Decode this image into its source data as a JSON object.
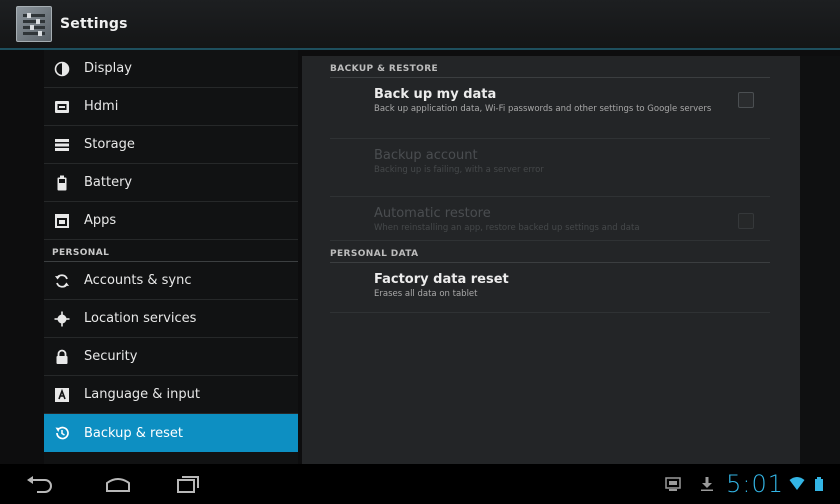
{
  "app": {
    "title": "Settings",
    "icon": "settings-app-icon"
  },
  "sidebar": {
    "items_top": [
      {
        "label": "Display",
        "icon": "display-icon"
      },
      {
        "label": "Hdmi",
        "icon": "hdmi-icon"
      },
      {
        "label": "Storage",
        "icon": "storage-icon"
      },
      {
        "label": "Battery",
        "icon": "battery-icon"
      },
      {
        "label": "Apps",
        "icon": "apps-icon"
      }
    ],
    "personal_header": "PERSONAL",
    "items_personal": [
      {
        "label": "Accounts & sync",
        "icon": "sync-icon"
      },
      {
        "label": "Location services",
        "icon": "location-icon"
      },
      {
        "label": "Security",
        "icon": "lock-icon"
      },
      {
        "label": "Language & input",
        "icon": "language-icon"
      },
      {
        "label": "Backup & reset",
        "icon": "backup-icon",
        "selected": true
      }
    ]
  },
  "content": {
    "backup_header": "BACKUP & RESTORE",
    "backup_prefs": [
      {
        "title": "Back up my data",
        "summary": "Back up application data, Wi-Fi passwords and other settings to Google servers",
        "checked": false,
        "enabled": true
      },
      {
        "title": "Backup account",
        "summary": "Backing up is failing, with a server error",
        "enabled": false
      },
      {
        "title": "Automatic restore",
        "summary": "When reinstalling an app, restore backed up settings and data",
        "checked": false,
        "enabled": false
      }
    ],
    "personal_data_header": "PERSONAL DATA",
    "factory": {
      "title": "Factory data reset",
      "summary": "Erases all data on tablet"
    }
  },
  "navbar": {
    "back_icon": "back-icon",
    "home_icon": "home-icon",
    "recents_icon": "recent-apps-icon"
  },
  "status": {
    "time": "5:01",
    "icons": [
      "screenshot-icon",
      "download-icon",
      "wifi-icon",
      "battery-status-icon"
    ],
    "accent": "#33b5e5"
  },
  "colors": {
    "selected": "#0d8fc2",
    "accent": "#33b5e5"
  }
}
